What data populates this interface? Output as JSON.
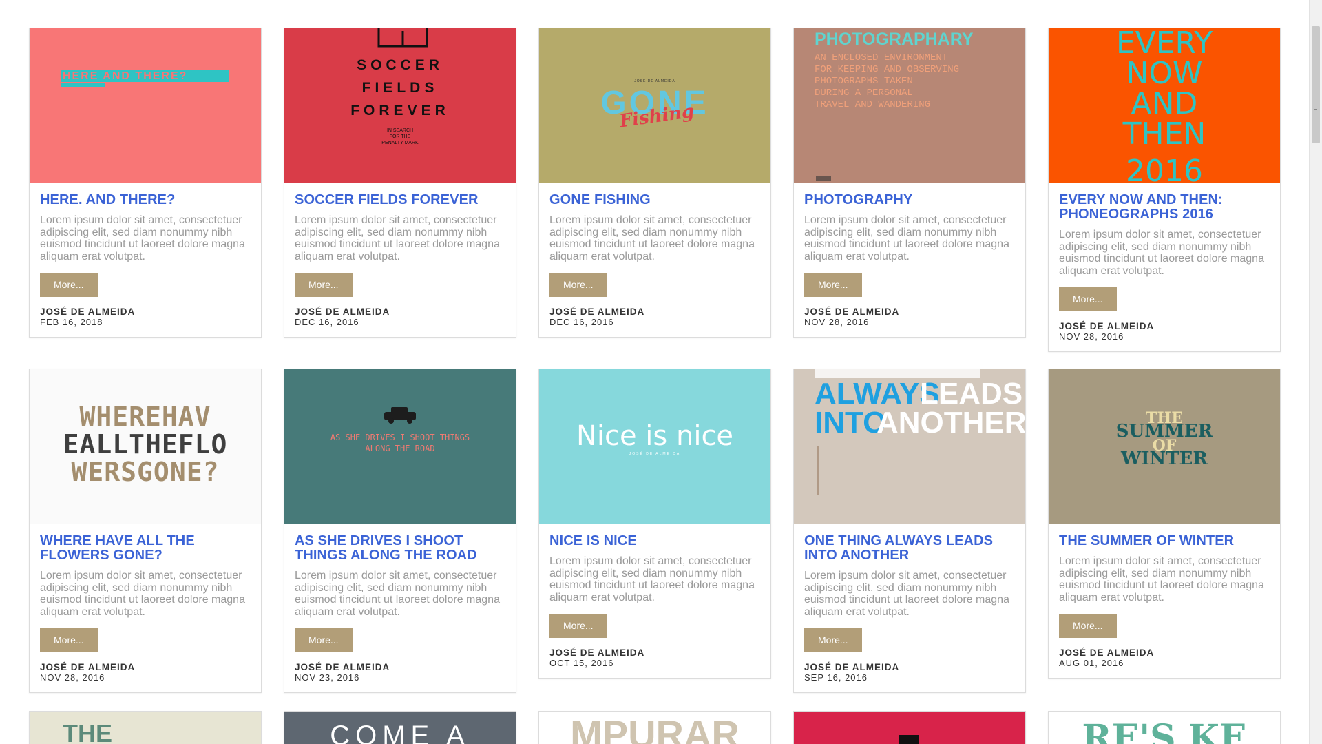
{
  "more_label": "More...",
  "cards": [
    {
      "title": "HERE. AND THERE?",
      "excerpt": "Lorem ipsum dolor sit amet, consectetuer adipiscing elit, sed diam nonummy nibh euismod tincidunt ut laoreet dolore magna aliquam erat volutpat.",
      "author": "JOSÉ DE ALMEIDA",
      "date": "FEB 16, 2018",
      "bg": "#f87676",
      "art_text": "HERE     AND THERE?"
    },
    {
      "title": "SOCCER FIELDS FOREVER",
      "excerpt": "Lorem ipsum dolor sit amet, consectetuer adipiscing elit, sed diam nonummy nibh euismod tincidunt ut laoreet dolore magna aliquam erat volutpat.",
      "author": "JOSÉ DE ALMEIDA",
      "date": "DEC 16, 2016",
      "bg": "#d93c48",
      "art_text": [
        "SOCCER",
        "FIELDS",
        "FOREVER"
      ],
      "art_sub": [
        "IN SEARCH",
        "FOR THE",
        "PENALTY MARK"
      ]
    },
    {
      "title": "GONE FISHING",
      "excerpt": "Lorem ipsum dolor sit amet, consectetuer adipiscing elit, sed diam nonummy nibh euismod tincidunt ut laoreet dolore magna aliquam erat volutpat.",
      "author": "JOSÉ DE ALMEIDA",
      "date": "DEC 16, 2016",
      "bg": "#b5aa6a",
      "art_text": "GONE",
      "art_script": "Fishing",
      "art_small": "JOSÉ DE ALMEIDA"
    },
    {
      "title": "PHOTOGRAPHY",
      "excerpt": "Lorem ipsum dolor sit amet, consectetuer adipiscing elit, sed diam nonummy nibh euismod tincidunt ut laoreet dolore magna aliquam erat volutpat.",
      "author": "JOSÉ DE ALMEIDA",
      "date": "NOV 28, 2016",
      "bg": "#b78775",
      "art_text": "PHOTOGRAPHARY",
      "art_sub": [
        "AN ENCLOSED ENVIRONMENT",
        "FOR KEEPING AND OBSERVING",
        "PHOTOGRAPHS TAKEN",
        "DURING A PERSONAL",
        "TRAVEL AND WANDERING"
      ]
    },
    {
      "title": "EVERY NOW AND THEN: PHONEOGRAPHS 2016",
      "excerpt": "Lorem ipsum dolor sit amet, consectetuer adipiscing elit, sed diam nonummy nibh euismod tincidunt ut laoreet dolore magna aliquam erat volutpat.",
      "author": "JOSÉ DE ALMEIDA",
      "date": "NOV 28, 2016",
      "bg": "#fa5400",
      "art_text": [
        "EVERY",
        "NOW",
        "AND",
        "THEN",
        "2016"
      ]
    },
    {
      "title": "WHERE HAVE ALL THE FLOWERS GONE?",
      "excerpt": "Lorem ipsum dolor sit amet, consectetuer adipiscing elit, sed diam nonummy nibh euismod tincidunt ut laoreet dolore magna aliquam erat volutpat.",
      "author": "JOSÉ DE ALMEIDA",
      "date": "NOV 28, 2016",
      "bg": "#fafafa",
      "art_text": [
        "WHEREHAV",
        "EALLTHEFLO",
        "WERSGONE?"
      ]
    },
    {
      "title": "AS SHE DRIVES I SHOOT THINGS ALONG THE ROAD",
      "excerpt": "Lorem ipsum dolor sit amet, consectetuer adipiscing elit, sed diam nonummy nibh euismod tincidunt ut laoreet dolore magna aliquam erat volutpat.",
      "author": "JOSÉ DE ALMEIDA",
      "date": "NOV 23, 2016",
      "bg": "#477a79",
      "art_text": [
        "AS SHE DRIVES I SHOOT THINGS",
        "ALONG THE ROAD"
      ]
    },
    {
      "title": "NICE IS NICE",
      "excerpt": "Lorem ipsum dolor sit amet, consectetuer adipiscing elit, sed diam nonummy nibh euismod tincidunt ut laoreet dolore magna aliquam erat volutpat.",
      "author": "JOSÉ DE ALMEIDA",
      "date": "OCT 15, 2016",
      "bg": "#86d8dc",
      "art_text": "Nice is nice",
      "art_small": "JOSÉ DE ALMEIDA"
    },
    {
      "title": "ONE THING ALWAYS LEADS INTO ANOTHER",
      "excerpt": "Lorem ipsum dolor sit amet, consectetuer adipiscing elit, sed diam nonummy nibh euismod tincidunt ut laoreet dolore magna aliquam erat volutpat.",
      "author": "JOSÉ DE ALMEIDA",
      "date": "SEP 16, 2016",
      "bg": "#d3c8bc",
      "art_text": [
        "ALWAYS",
        "LEADS",
        "INTO",
        "ANOTHER"
      ]
    },
    {
      "title": "THE SUMMER OF WINTER",
      "excerpt": "Lorem ipsum dolor sit amet, consectetuer adipiscing elit, sed diam nonummy nibh euismod tincidunt ut laoreet dolore magna aliquam erat volutpat.",
      "author": "JOSÉ DE ALMEIDA",
      "date": "AUG 01, 2016",
      "bg": "#a69a80",
      "art_text": [
        "THE",
        "SUMMER",
        "OF",
        "WINTER"
      ]
    }
  ],
  "row3": [
    {
      "bg": "#e7e5d3",
      "art_text": "THE"
    },
    {
      "bg": "#5e6771",
      "art_text": "COME A"
    },
    {
      "bg": "#ffffff",
      "art_text": "MPURAR"
    },
    {
      "bg": "#d8234a",
      "art_text": ""
    },
    {
      "bg": "#ffffff",
      "art_text": "RE'S KE"
    }
  ]
}
